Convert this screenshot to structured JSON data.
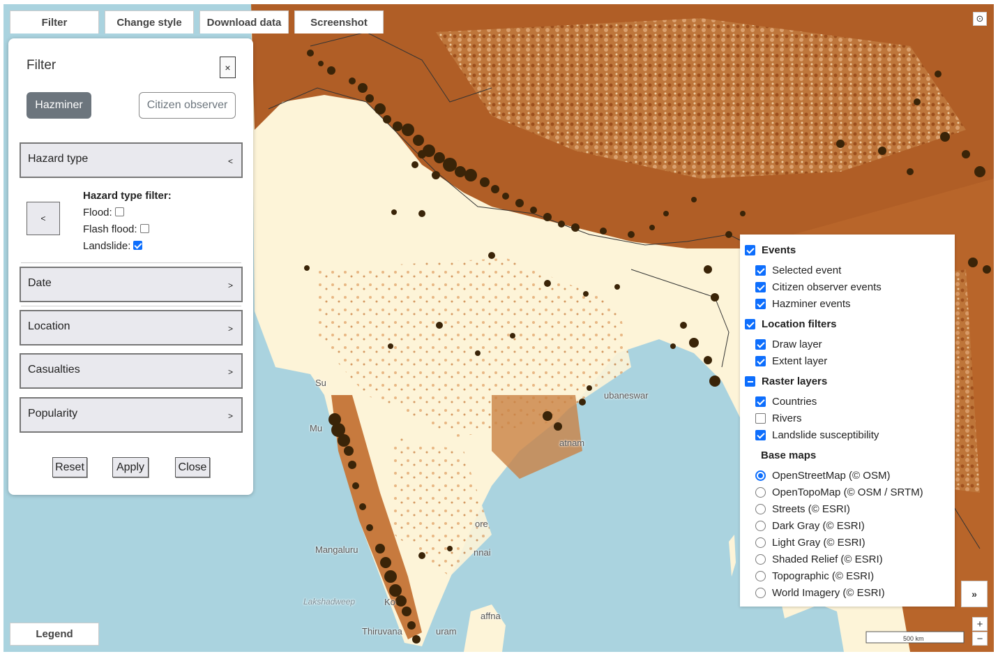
{
  "toolbar": {
    "filter": "Filter",
    "change_style": "Change style",
    "download_data": "Download data",
    "screenshot": "Screenshot"
  },
  "filter_panel": {
    "title": "Filter",
    "close_x": "×",
    "tabs": {
      "hazminer": "Hazminer",
      "citizen": "Citizen observer"
    },
    "hazard_type": {
      "label": "Hazard type",
      "chevron": "<",
      "collapse_button": "<",
      "filter_heading": "Hazard type filter:",
      "options": [
        {
          "label": "Flood:",
          "checked": false
        },
        {
          "label": "Flash flood:",
          "checked": false
        },
        {
          "label": "Landslide:",
          "checked": true
        }
      ]
    },
    "sections": [
      {
        "label": "Date",
        "chevron": ">"
      },
      {
        "label": "Location",
        "chevron": ">"
      },
      {
        "label": "Casualties",
        "chevron": ">"
      },
      {
        "label": "Popularity",
        "chevron": ">"
      }
    ],
    "buttons": {
      "reset": "Reset",
      "apply": "Apply",
      "close": "Close"
    }
  },
  "layers": {
    "events": {
      "label": "Events",
      "state": "checked",
      "items": [
        {
          "label": "Selected event",
          "checked": true
        },
        {
          "label": "Citizen observer events",
          "checked": true
        },
        {
          "label": "Hazminer events",
          "checked": true
        }
      ]
    },
    "location_filters": {
      "label": "Location filters",
      "state": "checked",
      "items": [
        {
          "label": "Draw layer",
          "checked": true
        },
        {
          "label": "Extent layer",
          "checked": true
        }
      ]
    },
    "raster_layers": {
      "label": "Raster layers",
      "state": "indeterminate",
      "items": [
        {
          "label": "Countries",
          "checked": true
        },
        {
          "label": "Rivers",
          "checked": false
        },
        {
          "label": "Landslide susceptibility",
          "checked": true
        }
      ]
    },
    "base_maps": {
      "label": "Base maps",
      "selected": "OpenStreetMap (© OSM)",
      "items": [
        "OpenStreetMap (© OSM)",
        "OpenTopoMap (© OSM / SRTM)",
        "Streets (© ESRI)",
        "Dark Gray (© ESRI)",
        "Light Gray (© ESRI)",
        "Shaded Relief (© ESRI)",
        "Topographic (© ESRI)",
        "World Imagery (© ESRI)"
      ]
    }
  },
  "map_labels": {
    "bhubaneswar": "ubaneswar",
    "patnam": "atnam",
    "su": "Su",
    "mu": "Mu",
    "ore": "ore",
    "nai": "nnai",
    "mangaluru": "Mangaluru",
    "lakshadweep": "Lakshadweep",
    "ko": "Ko",
    "affna": "affna",
    "thiruvana": "Thiruvana",
    "uram": "uram"
  },
  "legend": "Legend",
  "scale": "500 km",
  "controls": {
    "expand": "»",
    "zoom_in": "+",
    "zoom_out": "−",
    "locate": "⊙"
  },
  "colors": {
    "water": "#aad3df",
    "land_low": "#fdf4d8",
    "land_high": "#a6501e",
    "event_dot": "#3a2408",
    "accent": "#0d6efd"
  }
}
